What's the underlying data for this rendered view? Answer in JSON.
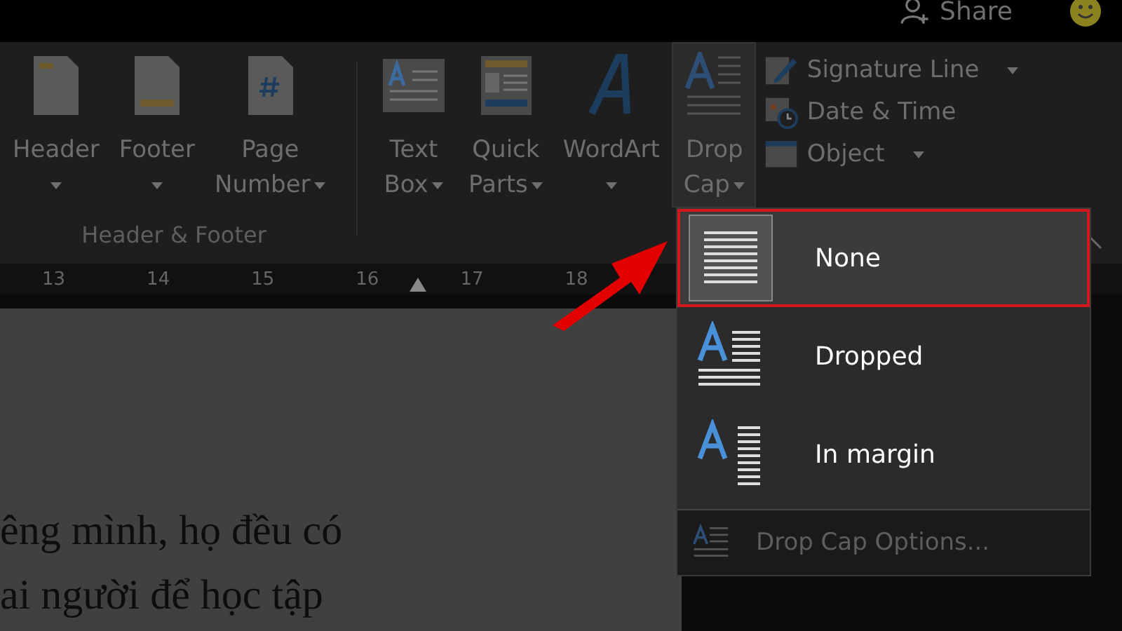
{
  "title_bar": {
    "share": "Share"
  },
  "ribbon": {
    "groups": [
      {
        "label": "Header & Footer",
        "buttons": [
          {
            "kind": "header",
            "lines": [
              "Header"
            ],
            "dropdown": true,
            "selected": false
          },
          {
            "kind": "footer",
            "lines": [
              "Footer"
            ],
            "dropdown": true,
            "selected": false
          },
          {
            "kind": "page-number",
            "lines": [
              "Page",
              "Number"
            ],
            "dropdown": true,
            "selected": false
          }
        ]
      },
      {
        "buttons": [
          {
            "kind": "text-box",
            "lines": [
              "Text",
              "Box"
            ],
            "dropdown": true,
            "selected": false
          },
          {
            "kind": "quick-parts",
            "lines": [
              "Quick",
              "Parts"
            ],
            "dropdown": true,
            "selected": false
          },
          {
            "kind": "wordart",
            "lines": [
              "WordArt"
            ],
            "dropdown": true,
            "selected": false
          },
          {
            "kind": "drop-cap",
            "lines": [
              "Drop",
              "Cap"
            ],
            "dropdown": true,
            "selected": true
          }
        ],
        "small_buttons": [
          {
            "kind": "signature",
            "label": "Signature Line",
            "dropdown": true
          },
          {
            "kind": "date",
            "label": "Date & Time",
            "dropdown": false
          },
          {
            "kind": "object",
            "label": "Object",
            "dropdown": true
          }
        ]
      }
    ]
  },
  "ruler": {
    "ticks": [
      "13",
      "14",
      "15",
      "16",
      "17",
      "18"
    ]
  },
  "document": {
    "lines": [
      "êng mình, họ đều có",
      "ai người để học tập"
    ]
  },
  "drop_cap_menu": {
    "items": [
      {
        "kind": "none",
        "label": "None",
        "selected": true
      },
      {
        "kind": "dropped",
        "label": "Dropped",
        "selected": false
      },
      {
        "kind": "in-margin",
        "label": "In margin",
        "selected": false
      }
    ],
    "options": "Drop Cap Options..."
  }
}
